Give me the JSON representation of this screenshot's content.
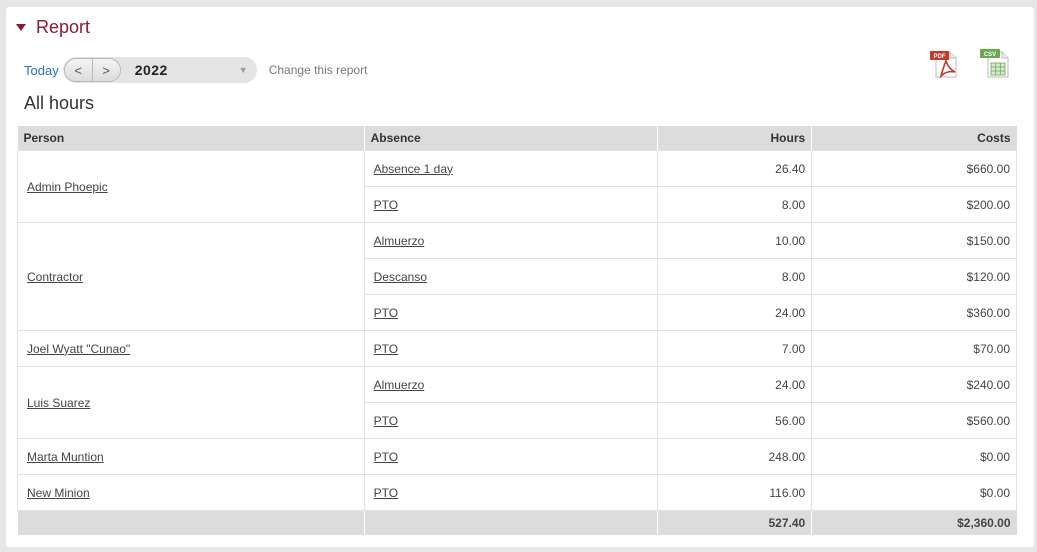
{
  "section": {
    "title": "Report"
  },
  "toolbar": {
    "today_label": "Today",
    "prev_label": "<",
    "next_label": ">",
    "year": "2022",
    "dropdown_arrow": "▼",
    "change_label": "Change this report"
  },
  "heading": "All hours",
  "exports": {
    "pdf_label": "PDF",
    "csv_label": "CSV"
  },
  "table": {
    "columns": {
      "person": "Person",
      "absence": "Absence",
      "hours": "Hours",
      "costs": "Costs"
    },
    "groups": [
      {
        "person": "Admin Phoepic",
        "rows": [
          {
            "absence": "Absence 1 day",
            "hours": "26.40",
            "costs": "$660.00"
          },
          {
            "absence": "PTO",
            "hours": "8.00",
            "costs": "$200.00"
          }
        ]
      },
      {
        "person": "Contractor",
        "rows": [
          {
            "absence": "Almuerzo",
            "hours": "10.00",
            "costs": "$150.00"
          },
          {
            "absence": "Descanso",
            "hours": "8.00",
            "costs": "$120.00"
          },
          {
            "absence": "PTO",
            "hours": "24.00",
            "costs": "$360.00"
          }
        ]
      },
      {
        "person": "Joel Wyatt \"Cunao\"",
        "rows": [
          {
            "absence": "PTO",
            "hours": "7.00",
            "costs": "$70.00"
          }
        ]
      },
      {
        "person": "Luis Suarez",
        "rows": [
          {
            "absence": "Almuerzo",
            "hours": "24.00",
            "costs": "$240.00"
          },
          {
            "absence": "PTO",
            "hours": "56.00",
            "costs": "$560.00"
          }
        ]
      },
      {
        "person": "Marta Muntion",
        "rows": [
          {
            "absence": "PTO",
            "hours": "248.00",
            "costs": "$0.00"
          }
        ]
      },
      {
        "person": "New Minion",
        "rows": [
          {
            "absence": "PTO",
            "hours": "116.00",
            "costs": "$0.00"
          }
        ]
      }
    ],
    "totals": {
      "hours": "527.40",
      "costs": "$2,360.00"
    }
  },
  "colors": {
    "accent": "#8b1a2b",
    "link": "#2a6ebb",
    "pdf": "#c0392b",
    "csv": "#6aa84f"
  }
}
